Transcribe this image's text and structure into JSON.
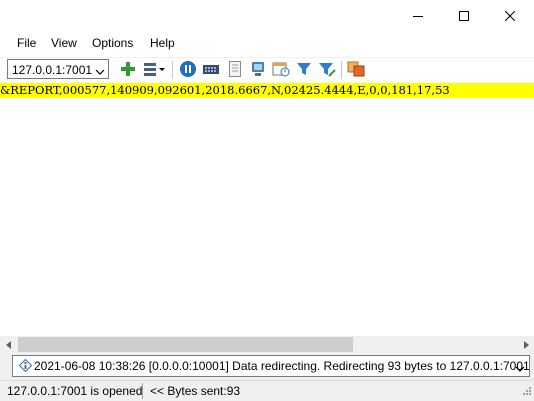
{
  "window": {
    "minimize_icon": "minimize-icon",
    "maximize_icon": "maximize-icon",
    "close_icon": "close-icon"
  },
  "menu": {
    "file": "File",
    "view": "View",
    "options": "Options",
    "help": "Help"
  },
  "toolbar": {
    "connection_value": "127.0.0.1:7001",
    "icons": [
      "add-icon",
      "list-menu-icon",
      "pause-icon",
      "port-icon",
      "document-icon",
      "device-icon",
      "schedule-icon",
      "filter-icon",
      "filter-edit-icon",
      "copy-icon"
    ]
  },
  "data": {
    "line": "&REPORT,000577,140909,092601,2018.6667,N,02425.4444,E,0,0,181,17,53"
  },
  "log": {
    "message": "2021-06-08 10:38:26 [0.0.0.0:10001] Data redirecting. Redirecting 93 bytes to 127.0.0.1:7001"
  },
  "status": {
    "connection": "127.0.0.1:7001 is opened",
    "bytes": "<< Bytes sent:93"
  },
  "colors": {
    "highlight": "#ffff00",
    "accent_blue": "#1b6ec2",
    "accent_green": "#2e9e2e"
  }
}
